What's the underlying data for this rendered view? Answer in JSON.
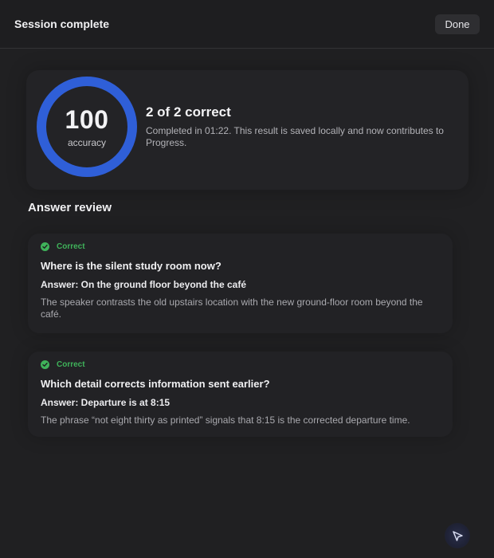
{
  "header": {
    "title": "Session complete",
    "done_label": "Done"
  },
  "result": {
    "score": "100",
    "score_label": "accuracy",
    "accuracy_fraction": 1.0,
    "heading": "2 of 2 correct",
    "description": "Completed in 01:22. This result is saved locally and now contributes to Progress."
  },
  "review": {
    "title": "Answer review",
    "items": [
      {
        "status": "Correct",
        "question": "Where is the silent study room now?",
        "answer": "Answer: On the ground floor beyond the café",
        "explanation": "The speaker contrasts the old upstairs location with the new ground-floor room beyond the café."
      },
      {
        "status": "Correct",
        "question": "Which detail corrects information sent earlier?",
        "answer": "Answer: Departure is at 8:15",
        "explanation": "The phrase “not eight thirty as printed” signals that 8:15 is the corrected departure time."
      }
    ]
  },
  "colors": {
    "accent_ring": "#2f5fd8",
    "correct_green": "#3fb25a",
    "background": "#202022"
  },
  "icons": {
    "status": "check-circle-icon",
    "fab": "cursor-arrow-icon"
  }
}
